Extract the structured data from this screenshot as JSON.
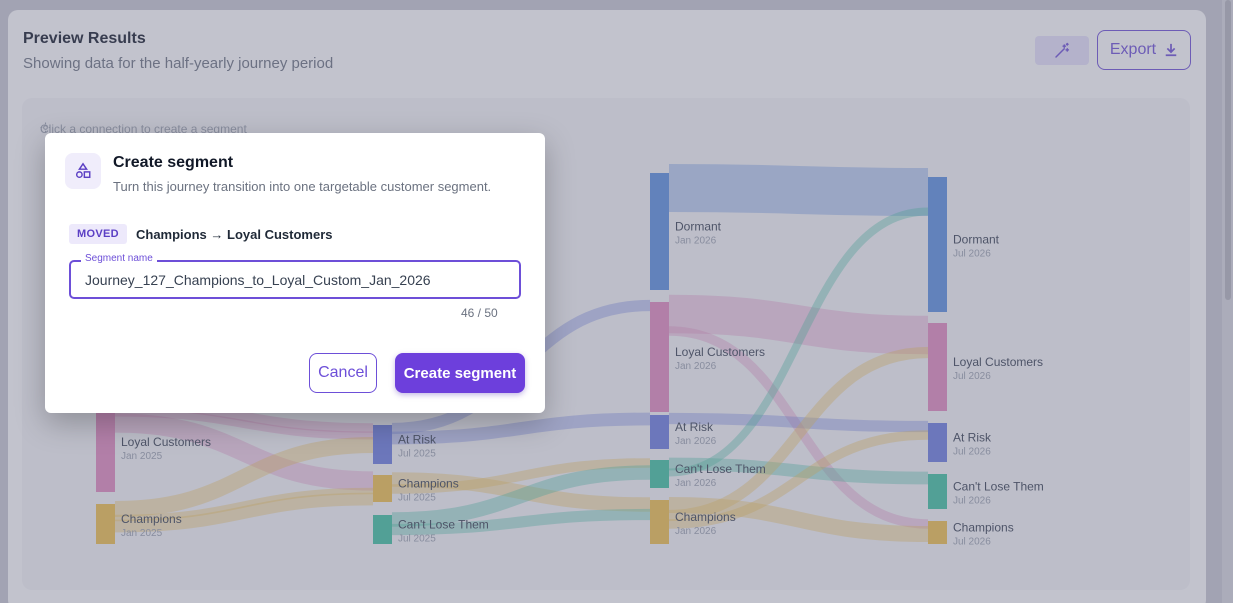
{
  "header": {
    "title": "Preview Results",
    "subtitle": "Showing data for the half-yearly journey period",
    "export_label": "Export",
    "magic_icon": "magic-wand-icon",
    "export_icon": "download-icon"
  },
  "chart": {
    "hint": "Click a connection to create a segment",
    "columns": [
      {
        "nodes": [
          {
            "label": "Loyal Customers",
            "period": "Jan 2025",
            "color": "#e48bc0"
          },
          {
            "label": "Champions",
            "period": "Jan 2025",
            "color": "#f1c24a"
          }
        ]
      },
      {
        "nodes": [
          {
            "label": "At Risk",
            "period": "Jul 2025",
            "color": "#6b7de0"
          },
          {
            "label": "Champions",
            "period": "Jul 2025",
            "color": "#f1c24a"
          },
          {
            "label": "Can't Lose Them",
            "period": "Jul 2025",
            "color": "#3fc3a0"
          }
        ]
      },
      {
        "nodes": [
          {
            "label": "Dormant",
            "period": "Jan 2026",
            "color": "#5a8fe0"
          },
          {
            "label": "Loyal Customers",
            "period": "Jan 2026",
            "color": "#e48bc0"
          },
          {
            "label": "At Risk",
            "period": "Jan 2026",
            "color": "#6b7de0"
          },
          {
            "label": "Can't Lose Them",
            "period": "Jan 2026",
            "color": "#3fc3a0"
          },
          {
            "label": "Champions",
            "period": "Jan 2026",
            "color": "#f1c24a"
          }
        ]
      },
      {
        "nodes": [
          {
            "label": "Dormant",
            "period": "Jul 2026",
            "color": "#5a8fe0"
          },
          {
            "label": "Loyal Customers",
            "period": "Jul 2026",
            "color": "#e48bc0"
          },
          {
            "label": "At Risk",
            "period": "Jul 2026",
            "color": "#6b7de0"
          },
          {
            "label": "Can't Lose Them",
            "period": "Jul 2026",
            "color": "#3fc3a0"
          },
          {
            "label": "Champions",
            "period": "Jul 2026",
            "color": "#f1c24a"
          }
        ]
      }
    ]
  },
  "modal": {
    "icon": "shapes-icon",
    "title": "Create segment",
    "description": "Turn this journey transition into one targetable customer segment.",
    "badge": "MOVED",
    "transition": "Champions → Loyal Customers",
    "field_label": "Segment name",
    "field_value": "Journey_127_Champions_to_Loyal_Custom_Jan_2026",
    "counter": "46 / 50",
    "cancel_label": "Cancel",
    "create_label": "Create segment"
  },
  "colors": {
    "accent": "#6d3fdc",
    "overlay": "#6e7087"
  }
}
